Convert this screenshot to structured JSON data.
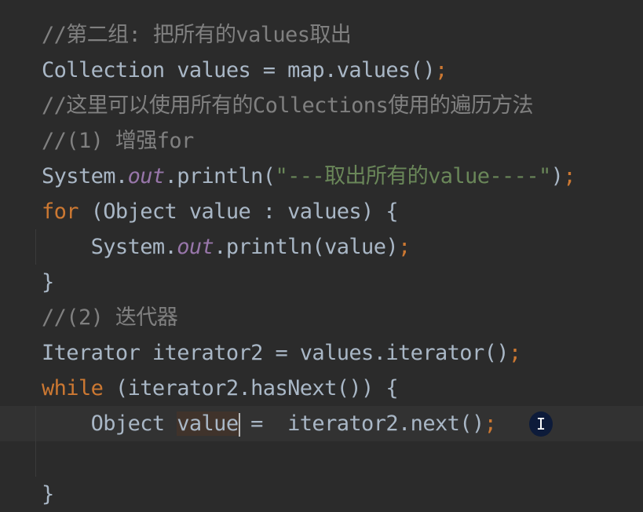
{
  "editor": {
    "current_line": 11,
    "lines": [
      [
        {
          "t": "//第二组: 把所有的values取出",
          "c": "cm"
        }
      ],
      [
        {
          "t": "Collection values = map.values()",
          "c": ""
        },
        {
          "t": ";",
          "c": "pu"
        }
      ],
      [
        {
          "t": "//这里可以使用所有的Collections使用的遍历方法",
          "c": "cm"
        }
      ],
      [
        {
          "t": "//(1) 增强for",
          "c": "cm"
        }
      ],
      [
        {
          "t": "System.",
          "c": ""
        },
        {
          "t": "out",
          "c": "fi"
        },
        {
          "t": ".println(",
          "c": ""
        },
        {
          "t": "\"---取出所有的value----\"",
          "c": "st"
        },
        {
          "t": ")",
          "c": ""
        },
        {
          "t": ";",
          "c": "pu"
        }
      ],
      [
        {
          "t": "for",
          "c": "kw"
        },
        {
          "t": " (Object value : values) {",
          "c": ""
        }
      ],
      [
        {
          "t": "    System.",
          "c": ""
        },
        {
          "t": "out",
          "c": "fi"
        },
        {
          "t": ".println(value)",
          "c": ""
        },
        {
          "t": ";",
          "c": "pu"
        }
      ],
      [
        {
          "t": "}",
          "c": ""
        }
      ],
      [
        {
          "t": "//(2) 迭代器",
          "c": "cm"
        }
      ],
      [
        {
          "t": "Iterator iterator2 = values.iterator()",
          "c": ""
        },
        {
          "t": ";",
          "c": "pu"
        }
      ],
      [
        {
          "t": "while",
          "c": "kw"
        },
        {
          "t": " (iterator2.hasNext()) {",
          "c": ""
        }
      ],
      [
        {
          "t": "    Object ",
          "c": ""
        },
        {
          "t": "value",
          "c": "hl"
        },
        {
          "t": "|caret|",
          "c": "caret"
        },
        {
          "t": " =  iterator2.next()",
          "c": ""
        },
        {
          "t": ";",
          "c": "pu"
        }
      ],
      [],
      [
        {
          "t": "}",
          "c": ""
        }
      ]
    ]
  },
  "cursor_icon": "text-cursor-icon"
}
